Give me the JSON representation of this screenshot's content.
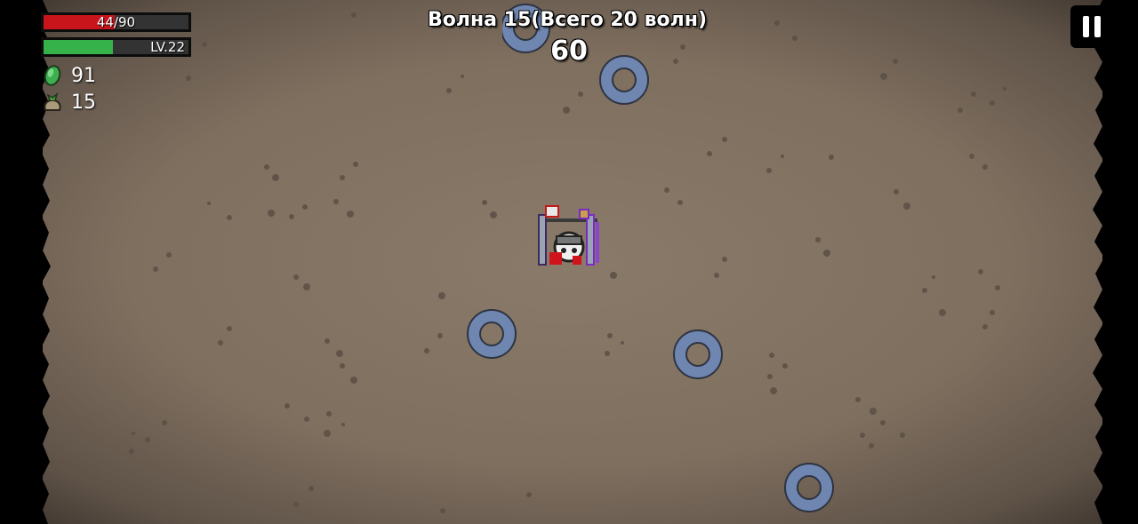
{
  "hud": {
    "hp_text": "44/90",
    "hp_fraction": 0.489,
    "level_text": "LV.22",
    "xp_fraction": 0.48,
    "materials_count": "91",
    "bag_count": "15",
    "hp_color": "#c8151c",
    "xp_color": "#35b34a"
  },
  "wave": {
    "title": "Волна 15(Всего 20 волн)",
    "timer": "60"
  },
  "icons": {
    "materials": "green-material-icon",
    "bag": "loot-bag-icon",
    "pause": "pause-icon"
  }
}
